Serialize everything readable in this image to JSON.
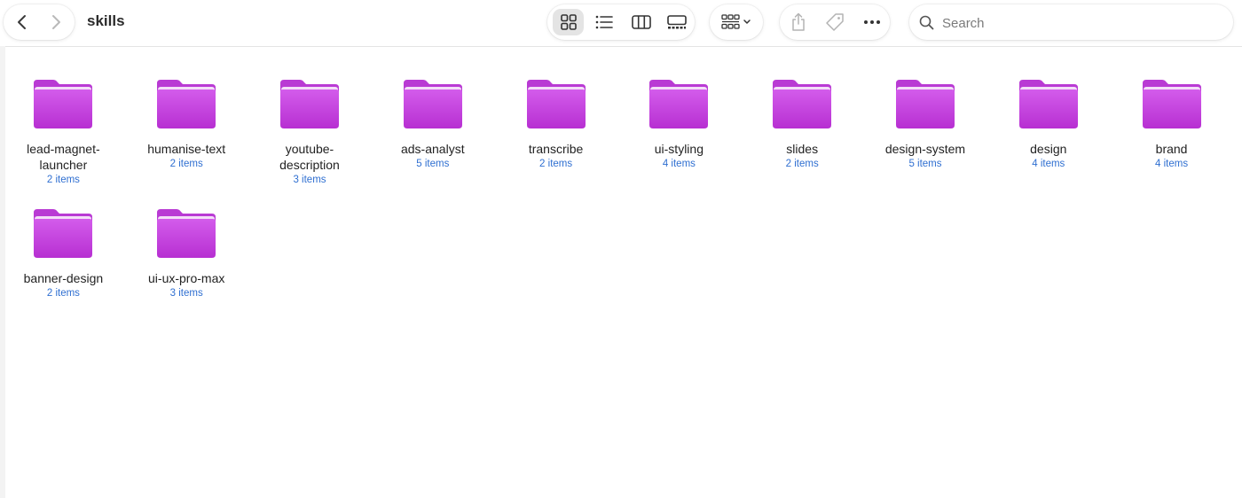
{
  "window": {
    "title": "skills"
  },
  "toolbar": {
    "back_icon": "chevron-left-icon",
    "forward_icon": "chevron-right-icon",
    "view_modes": [
      "icon-view",
      "list-view",
      "column-view",
      "gallery-view"
    ],
    "active_view": "icon-view",
    "group_icon": "group-by-icon",
    "share_icon": "share-icon",
    "tag_icon": "tag-icon",
    "more_icon": "ellipsis-icon"
  },
  "search": {
    "placeholder": "Search",
    "value": ""
  },
  "colors": {
    "folder": "#c93fe0",
    "item_count": "#2f6fd1"
  },
  "folders": [
    {
      "name": "lead-magnet-launcher",
      "count": "2 items"
    },
    {
      "name": "humanise-text",
      "count": "2 items"
    },
    {
      "name": "youtube-description",
      "count": "3 items"
    },
    {
      "name": "ads-analyst",
      "count": "5 items"
    },
    {
      "name": "transcribe",
      "count": "2 items"
    },
    {
      "name": "ui-styling",
      "count": "4 items"
    },
    {
      "name": "slides",
      "count": "2 items"
    },
    {
      "name": "design-system",
      "count": "5 items"
    },
    {
      "name": "design",
      "count": "4 items"
    },
    {
      "name": "brand",
      "count": "4 items"
    },
    {
      "name": "banner-design",
      "count": "2 items"
    },
    {
      "name": "ui-ux-pro-max",
      "count": "3 items"
    }
  ]
}
